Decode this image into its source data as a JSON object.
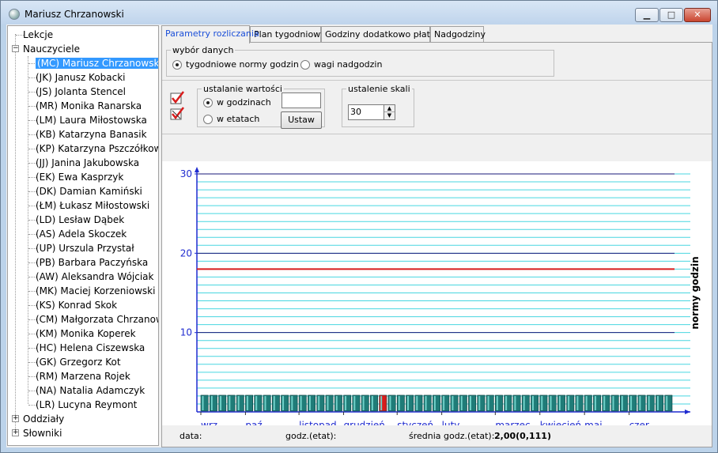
{
  "window": {
    "title": "Mariusz Chrzanowski"
  },
  "tree": {
    "root_items": [
      {
        "label": "Lekcje",
        "expander": ""
      },
      {
        "label": "Nauczyciele",
        "expander": "−"
      },
      {
        "label": "Oddziały",
        "expander": "+"
      },
      {
        "label": "Słowniki",
        "expander": "+"
      }
    ],
    "teachers": [
      "(MC) Mariusz Chrzanowski",
      "(JK) Janusz Kobacki",
      "(JS) Jolanta Stencel",
      "(MR) Monika Ranarska",
      "(LM) Laura Miłostowska",
      "(KB) Katarzyna Banasik",
      "(KP) Katarzyna Pszczółkowska",
      "(JJ) Janina Jakubowska",
      "(EK) Ewa Kasprzyk",
      "(DK) Damian Kamiński",
      "(ŁM) Łukasz Miłostowski",
      "(LD) Lesław Dąbek",
      "(AS) Adela Skoczek",
      "(UP) Urszula Przystał",
      "(PB) Barbara Paczyńska",
      "(AW) Aleksandra Wójciak",
      "(MK) Maciej Korzeniowski",
      "(KS) Konrad Skok",
      "(CM) Małgorzata Chrzanowska",
      "(KM) Monika Koperek",
      "(HC) Helena Ciszewska",
      "(GK) Grzegorz Kot",
      "(RM) Marzena Rojek",
      "(NA) Natalia Adamczyk",
      "(LR) Lucyna Reymont"
    ],
    "selected_index": 0
  },
  "tabs": [
    "Parametry rozliczania",
    "Plan tygodniowy",
    "Godziny dodatkowo płatne",
    "Nadgodziny"
  ],
  "wybor": {
    "legend": "wybór danych",
    "opt1": "tygodniowe normy godzin",
    "opt2": "wagi nadgodzin"
  },
  "ustalanie": {
    "legend": "ustalanie wartości",
    "opt1": "w godzinach",
    "opt2": "w etatach",
    "value": "",
    "button": "Ustaw"
  },
  "skala": {
    "legend": "ustalenie skali",
    "value": "30"
  },
  "colors": {
    "accent_red": "#d81c1c",
    "teal": "#1f7c78",
    "grid": "#48d6e0",
    "axis": "#1f2bd0"
  },
  "chart_data": {
    "type": "bar",
    "ylim": [
      0,
      30
    ],
    "yticks": [
      10,
      20,
      30
    ],
    "ylabel": "normy godzin",
    "month_labels": [
      "wrz",
      "paź",
      "listopad",
      "grudzień",
      "styczeń",
      "luty",
      "marzec",
      "kwiecień",
      "maj",
      "czer"
    ],
    "month_start_weeks": [
      0,
      5,
      11,
      16,
      22,
      27,
      33,
      38,
      43,
      48
    ],
    "norm_line": 18,
    "weeks": 53,
    "values": [
      2,
      2,
      2,
      2,
      2,
      2,
      2,
      2,
      2,
      2,
      2,
      2,
      2,
      2,
      2,
      2,
      2,
      2,
      2,
      2,
      2,
      2,
      2,
      2,
      2,
      2,
      2,
      2,
      2,
      2,
      2,
      2,
      2,
      2,
      2,
      2,
      2,
      2,
      2,
      2,
      2,
      2,
      2,
      2,
      2,
      2,
      2,
      2,
      2,
      2,
      2,
      2,
      2
    ],
    "highlight_week": 20
  },
  "status": {
    "data_label": "data:",
    "godz_label": "godz.(etat):",
    "srednia_label": "średnia godz.(etat):",
    "srednia_value": "2,00(0,111)"
  }
}
